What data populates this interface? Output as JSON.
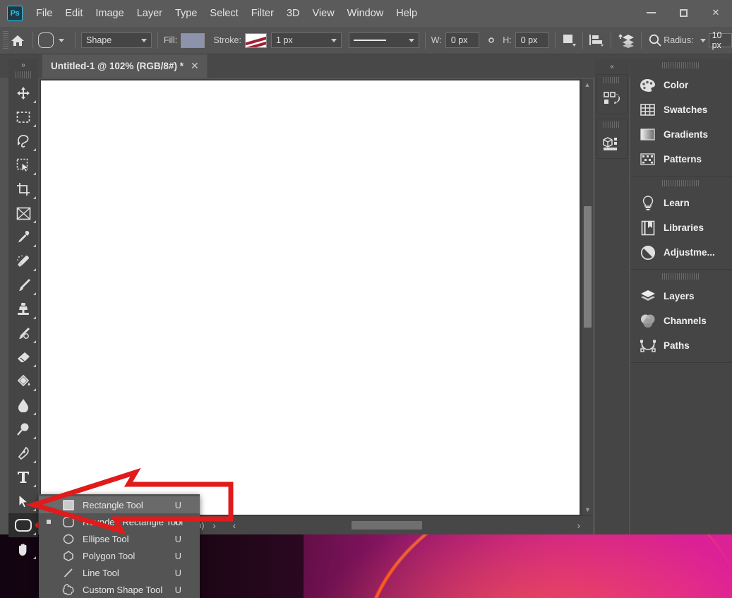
{
  "app": {
    "name": "Adobe Photoshop",
    "logo_text": "Ps"
  },
  "menubar": {
    "items": [
      {
        "label": "File"
      },
      {
        "label": "Edit"
      },
      {
        "label": "Image"
      },
      {
        "label": "Layer"
      },
      {
        "label": "Type"
      },
      {
        "label": "Select"
      },
      {
        "label": "Filter"
      },
      {
        "label": "3D"
      },
      {
        "label": "View"
      },
      {
        "label": "Window"
      },
      {
        "label": "Help"
      }
    ],
    "window_controls": {
      "minimize": "minimize",
      "maximize": "maximize",
      "close": "✕"
    }
  },
  "options_bar": {
    "home_icon": "home-icon",
    "tool_preset_icon": "rounded-rectangle-icon",
    "mode_value": "Shape",
    "fill_label": "Fill:",
    "fill_color": "#8d93ab",
    "stroke_label": "Stroke:",
    "stroke_width_value": "1 px",
    "stroke_style_icon": "line-style-icon",
    "width_label": "W:",
    "width_value": "0 px",
    "link_icon": "link-icon",
    "height_label": "H:",
    "height_value": "0 px",
    "path_ops_icon": "path-operations-icon",
    "path_align_icon": "path-alignment-icon",
    "path_arrange_icon": "path-arrangement-icon",
    "settings_icon": "gear-search-icon",
    "radius_label": "Radius:",
    "radius_value": "10 px"
  },
  "tab_bar": {
    "tabs": [
      {
        "title": "Untitled-1 @ 102% (RGB/8#) *",
        "close": "✕",
        "active": true
      }
    ]
  },
  "toolbar": {
    "expand_icon": "»",
    "tools": [
      {
        "name": "move-tool",
        "icon": "move-icon"
      },
      {
        "name": "rectangular-marquee-tool",
        "icon": "marquee-icon"
      },
      {
        "name": "lasso-tool",
        "icon": "lasso-icon"
      },
      {
        "name": "object-selection-tool",
        "icon": "quick-selection-icon"
      },
      {
        "name": "crop-tool",
        "icon": "crop-icon"
      },
      {
        "name": "frame-tool",
        "icon": "frame-icon"
      },
      {
        "name": "eyedropper-tool",
        "icon": "eyedropper-icon"
      },
      {
        "name": "spot-healing-brush-tool",
        "icon": "healing-brush-icon"
      },
      {
        "name": "brush-tool",
        "icon": "brush-icon"
      },
      {
        "name": "clone-stamp-tool",
        "icon": "clone-stamp-icon"
      },
      {
        "name": "history-brush-tool",
        "icon": "history-brush-icon"
      },
      {
        "name": "eraser-tool",
        "icon": "eraser-icon"
      },
      {
        "name": "gradient-tool",
        "icon": "paint-bucket-icon"
      },
      {
        "name": "blur-tool",
        "icon": "blur-drop-icon"
      },
      {
        "name": "dodge-tool",
        "icon": "dodge-icon"
      },
      {
        "name": "pen-tool",
        "icon": "pen-icon"
      },
      {
        "name": "horizontal-type-tool",
        "icon": "type-icon"
      },
      {
        "name": "path-selection-tool",
        "icon": "path-selection-icon"
      },
      {
        "name": "rectangle-tool",
        "icon": "rounded-rectangle-icon",
        "active": true
      },
      {
        "name": "hand-tool",
        "icon": "hand-icon"
      }
    ]
  },
  "tool_flyout": {
    "items": [
      {
        "label": "Rectangle Tool",
        "shortcut": "U",
        "icon": "rectangle-icon",
        "highlighted": true,
        "marked": false
      },
      {
        "label": "Rounded Rectangle Tool",
        "shortcut": "U",
        "icon": "rounded-rectangle-icon",
        "highlighted": false,
        "marked": true
      },
      {
        "label": "Ellipse Tool",
        "shortcut": "U",
        "icon": "ellipse-icon",
        "highlighted": false,
        "marked": false
      },
      {
        "label": "Polygon Tool",
        "shortcut": "U",
        "icon": "polygon-icon",
        "highlighted": false,
        "marked": false
      },
      {
        "label": "Line Tool",
        "shortcut": "U",
        "icon": "line-icon",
        "highlighted": false,
        "marked": false
      },
      {
        "label": "Custom Shape Tool",
        "shortcut": "U",
        "icon": "custom-shape-icon",
        "highlighted": false,
        "marked": false
      }
    ]
  },
  "status_bar": {
    "doc_info": "ppcm)",
    "next_arrow": "›",
    "prev_arrow": "‹",
    "end_arrow": "›"
  },
  "mini_dock": {
    "collapse_icon": "«",
    "items": [
      {
        "name": "history-panel-icon"
      },
      {
        "name": "3d-panel-icon"
      }
    ]
  },
  "right_panel": {
    "groups": [
      {
        "rows": [
          {
            "label": "Color",
            "icon": "color-palette-icon"
          },
          {
            "label": "Swatches",
            "icon": "swatches-grid-icon"
          },
          {
            "label": "Gradients",
            "icon": "gradient-icon"
          },
          {
            "label": "Patterns",
            "icon": "patterns-icon"
          }
        ]
      },
      {
        "rows": [
          {
            "label": "Learn",
            "icon": "lightbulb-icon"
          },
          {
            "label": "Libraries",
            "icon": "libraries-book-icon"
          },
          {
            "label": "Adjustme...",
            "icon": "adjustments-circle-icon"
          }
        ]
      },
      {
        "rows": [
          {
            "label": "Layers",
            "icon": "layers-stack-icon"
          },
          {
            "label": "Channels",
            "icon": "channels-venn-icon"
          },
          {
            "label": "Paths",
            "icon": "paths-curve-icon"
          }
        ]
      }
    ]
  },
  "annotation": {
    "type": "red-arrow",
    "color": "#e01b1b",
    "points_to": "rectangle-tool-button"
  }
}
